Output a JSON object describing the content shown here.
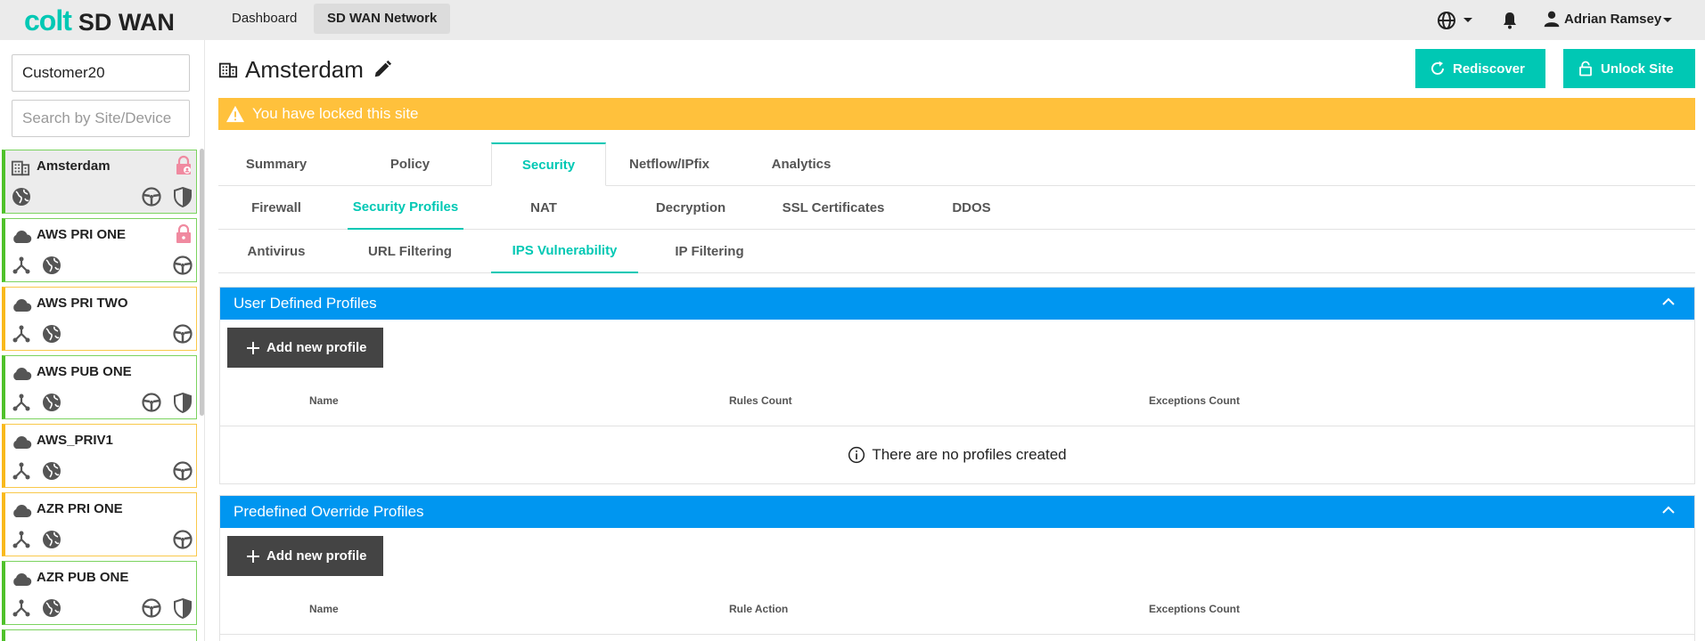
{
  "brand": {
    "logo_primary": "colt",
    "logo_secondary": "SD WAN",
    "accent": "#00c8b4"
  },
  "topnav": {
    "items": [
      {
        "label": "Dashboard"
      },
      {
        "label": "SD WAN Network"
      }
    ],
    "user_name": "Adrian Ramsey",
    "icons": [
      "globe-icon",
      "bell-icon",
      "user-icon"
    ]
  },
  "sidebar": {
    "customer_value": "Customer20",
    "search_placeholder": "Search by Site/Device",
    "sites": [
      {
        "name": "Amsterdam",
        "status": "green",
        "icon": "building-icon",
        "locked": true,
        "selected": true
      },
      {
        "name": "AWS PRI ONE",
        "status": "green",
        "icon": "cloud-icon",
        "locked": true
      },
      {
        "name": "AWS PRI TWO",
        "status": "orange",
        "icon": "cloud-icon"
      },
      {
        "name": "AWS PUB ONE",
        "status": "green",
        "icon": "cloud-icon"
      },
      {
        "name": "AWS_PRIV1",
        "status": "orange",
        "icon": "cloud-icon"
      },
      {
        "name": "AZR PRI ONE",
        "status": "orange",
        "icon": "cloud-icon"
      },
      {
        "name": "AZR PUB ONE",
        "status": "green",
        "icon": "cloud-icon"
      }
    ]
  },
  "page": {
    "title": "Amsterdam",
    "rediscover_label": "Rediscover",
    "unlock_label": "Unlock Site",
    "lock_message": "You have locked this site",
    "warning_color": "#ffc13c"
  },
  "tabs": {
    "main": [
      {
        "label": "Summary"
      },
      {
        "label": "Policy"
      },
      {
        "label": "Security"
      },
      {
        "label": "Netflow/IPfix"
      },
      {
        "label": "Analytics"
      }
    ],
    "security": [
      {
        "label": "Firewall"
      },
      {
        "label": "Security Profiles"
      },
      {
        "label": "NAT"
      },
      {
        "label": "Decryption"
      },
      {
        "label": "SSL Certificates"
      },
      {
        "label": "DDOS"
      }
    ],
    "profiles": [
      {
        "label": "Antivirus"
      },
      {
        "label": "URL Filtering"
      },
      {
        "label": "IPS Vulnerability"
      },
      {
        "label": "IP Filtering"
      }
    ],
    "active": {
      "main": "Security",
      "security": "Security Profiles",
      "profiles": "IPS Vulnerability"
    }
  },
  "panels": {
    "user_defined": {
      "title": "User Defined Profiles",
      "add_label": "Add new profile",
      "columns": [
        "Name",
        "Rules Count",
        "Exceptions Count"
      ],
      "empty_message": "There are no profiles created"
    },
    "predefined": {
      "title": "Predefined Override Profiles",
      "add_label": "Add new profile",
      "columns": [
        "Name",
        "Rule Action",
        "Exceptions Count"
      ]
    },
    "header_color": "#0096f0"
  }
}
